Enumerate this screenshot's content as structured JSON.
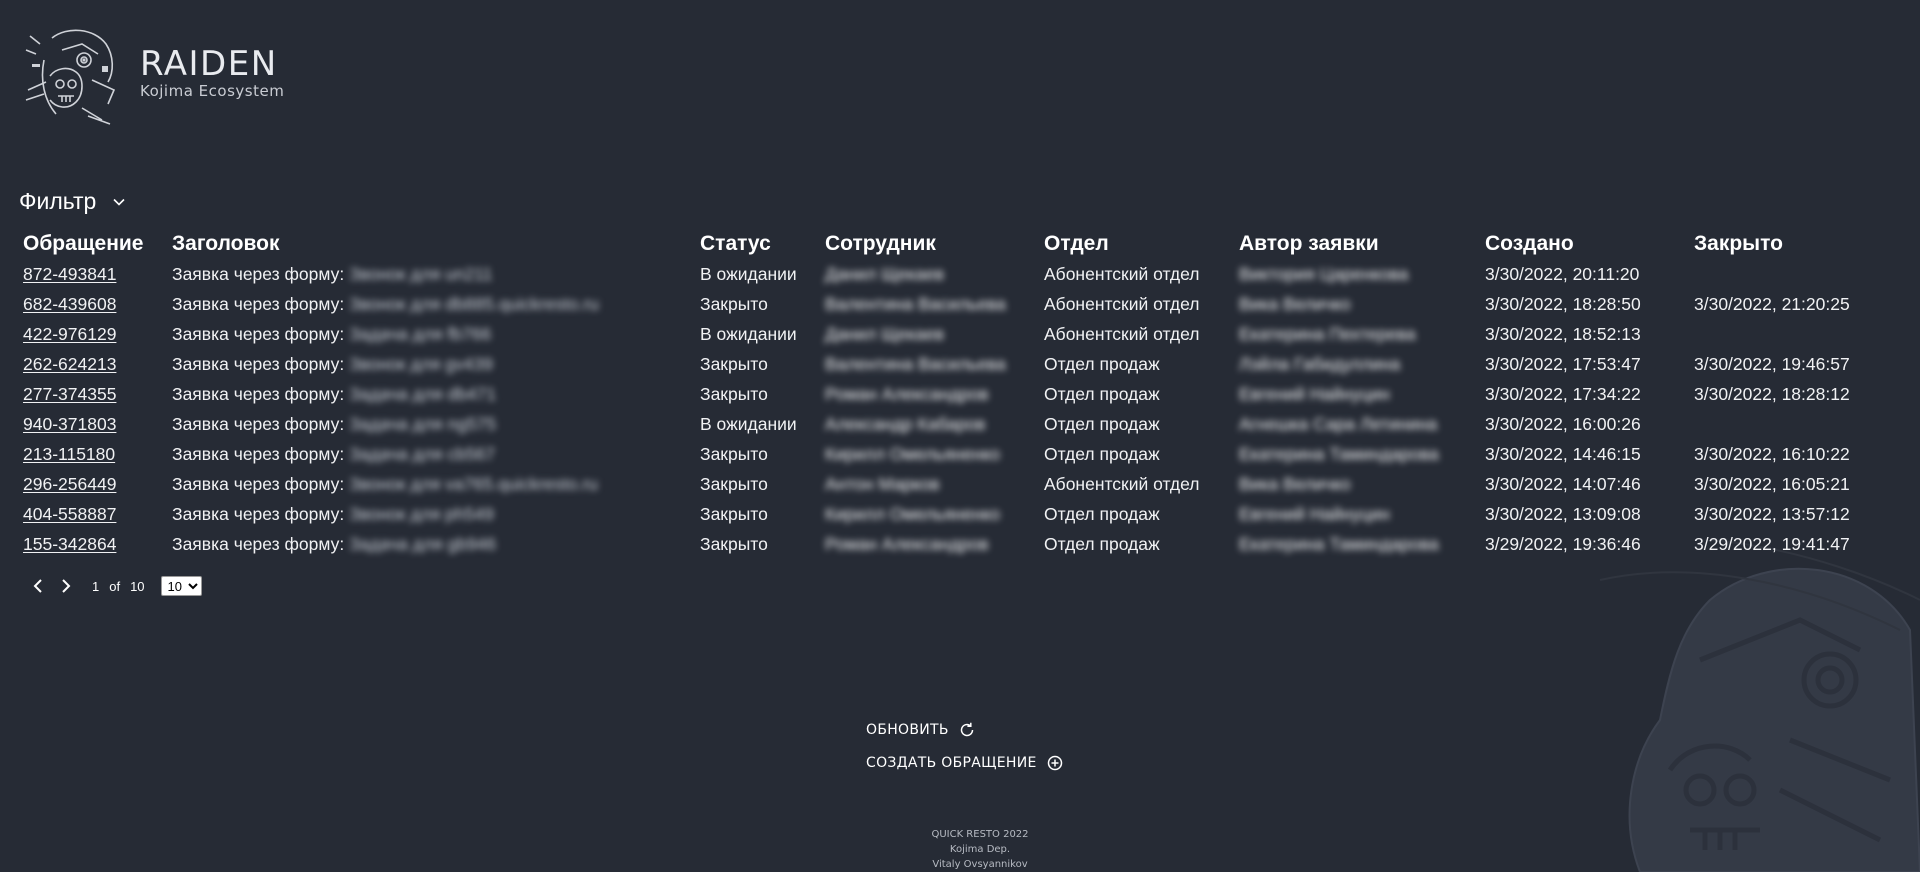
{
  "brand": {
    "title": "RAIDEN",
    "subtitle": "Kojima Ecosystem"
  },
  "filter": {
    "label": "Фильтр"
  },
  "table": {
    "columns": {
      "id": "Обращение",
      "title": "Заголовок",
      "status": "Статус",
      "employee": "Сотрудник",
      "department": "Отдел",
      "author": "Автор заявки",
      "created": "Создано",
      "closed": "Закрыто"
    },
    "title_prefix": "Заявка через форму: ",
    "rows": [
      {
        "id": "872-493841",
        "subject": "Звонок для un211",
        "status": "В ожидании",
        "employee": "Данил Щекаев",
        "department": "Абонентский отдел",
        "author": "Виктория Царенкова",
        "created": "3/30/2022, 20:11:20",
        "closed": ""
      },
      {
        "id": "682-439608",
        "subject": "Звонок для db885.quickresto.ru",
        "status": "Закрыто",
        "employee": "Валентина Васильева",
        "department": "Абонентский отдел",
        "author": "Вика Величко",
        "created": "3/30/2022, 18:28:50",
        "closed": "3/30/2022, 21:20:25"
      },
      {
        "id": "422-976129",
        "subject": "Задача для fb766",
        "status": "В ожидании",
        "employee": "Данил Щекаев",
        "department": "Абонентский отдел",
        "author": "Екатерина Пехтерева",
        "created": "3/30/2022, 18:52:13",
        "closed": ""
      },
      {
        "id": "262-624213",
        "subject": "Звонок для gv439",
        "status": "Закрыто",
        "employee": "Валентина Васильева",
        "department": "Отдел продаж",
        "author": "Лэйла Габидуллина",
        "created": "3/30/2022, 17:53:47",
        "closed": "3/30/2022, 19:46:57"
      },
      {
        "id": "277-374355",
        "subject": "Задача для db471",
        "status": "Закрыто",
        "employee": "Роман Александров",
        "department": "Отдел продаж",
        "author": "Евгений Найнуцин",
        "created": "3/30/2022, 17:34:22",
        "closed": "3/30/2022, 18:28:12"
      },
      {
        "id": "940-371803",
        "subject": "Задача для ng575",
        "status": "В ожидании",
        "employee": "Александр Кабаров",
        "department": "Отдел продаж",
        "author": "Агнешка Сара Летинина",
        "created": "3/30/2022, 16:00:26",
        "closed": ""
      },
      {
        "id": "213-115180",
        "subject": "Задача для cb567",
        "status": "Закрыто",
        "employee": "Кирилл Омельяненко",
        "department": "Отдел продаж",
        "author": "Екатерина Таминдарова",
        "created": "3/30/2022, 14:46:15",
        "closed": "3/30/2022, 16:10:22"
      },
      {
        "id": "296-256449",
        "subject": "Звонок для va765.quickresto.ru",
        "status": "Закрыто",
        "employee": "Антон Марков",
        "department": "Абонентский отдел",
        "author": "Вика Величко",
        "created": "3/30/2022, 14:07:46",
        "closed": "3/30/2022, 16:05:21"
      },
      {
        "id": "404-558887",
        "subject": "Звонок для ph549",
        "status": "Закрыто",
        "employee": "Кирилл Омельяненко",
        "department": "Отдел продаж",
        "author": "Евгений Найнуцин",
        "created": "3/30/2022, 13:09:08",
        "closed": "3/30/2022, 13:57:12"
      },
      {
        "id": "155-342864",
        "subject": "Задача для gb946",
        "status": "Закрыто",
        "employee": "Роман Александров",
        "department": "Отдел продаж",
        "author": "Екатерина Таминдарова",
        "created": "3/29/2022, 19:36:46",
        "closed": "3/29/2022, 19:41:47"
      }
    ]
  },
  "pagination": {
    "current": "1",
    "of_label": "of",
    "total": "10",
    "page_size": "10",
    "page_size_options": [
      "10"
    ]
  },
  "actions": {
    "refresh_label": "ОБНОВИТЬ",
    "create_label": "СОЗДАТЬ ОБРАЩЕНИЕ"
  },
  "footer": {
    "line1": "QUICK RESTO 2022",
    "line2": "Kojima Dep.",
    "line3": "Vitaly Ovsyannikov"
  },
  "colors": {
    "background": "#262b35",
    "text": "#ffffff",
    "muted_text": "#b7bbc3"
  },
  "icons": {
    "logo": "skull-helmet-emblem",
    "filter": "chevron-down-icon",
    "prev": "chevron-left-icon",
    "next": "chevron-right-icon",
    "refresh": "refresh-icon",
    "create": "plus-circle-icon"
  }
}
